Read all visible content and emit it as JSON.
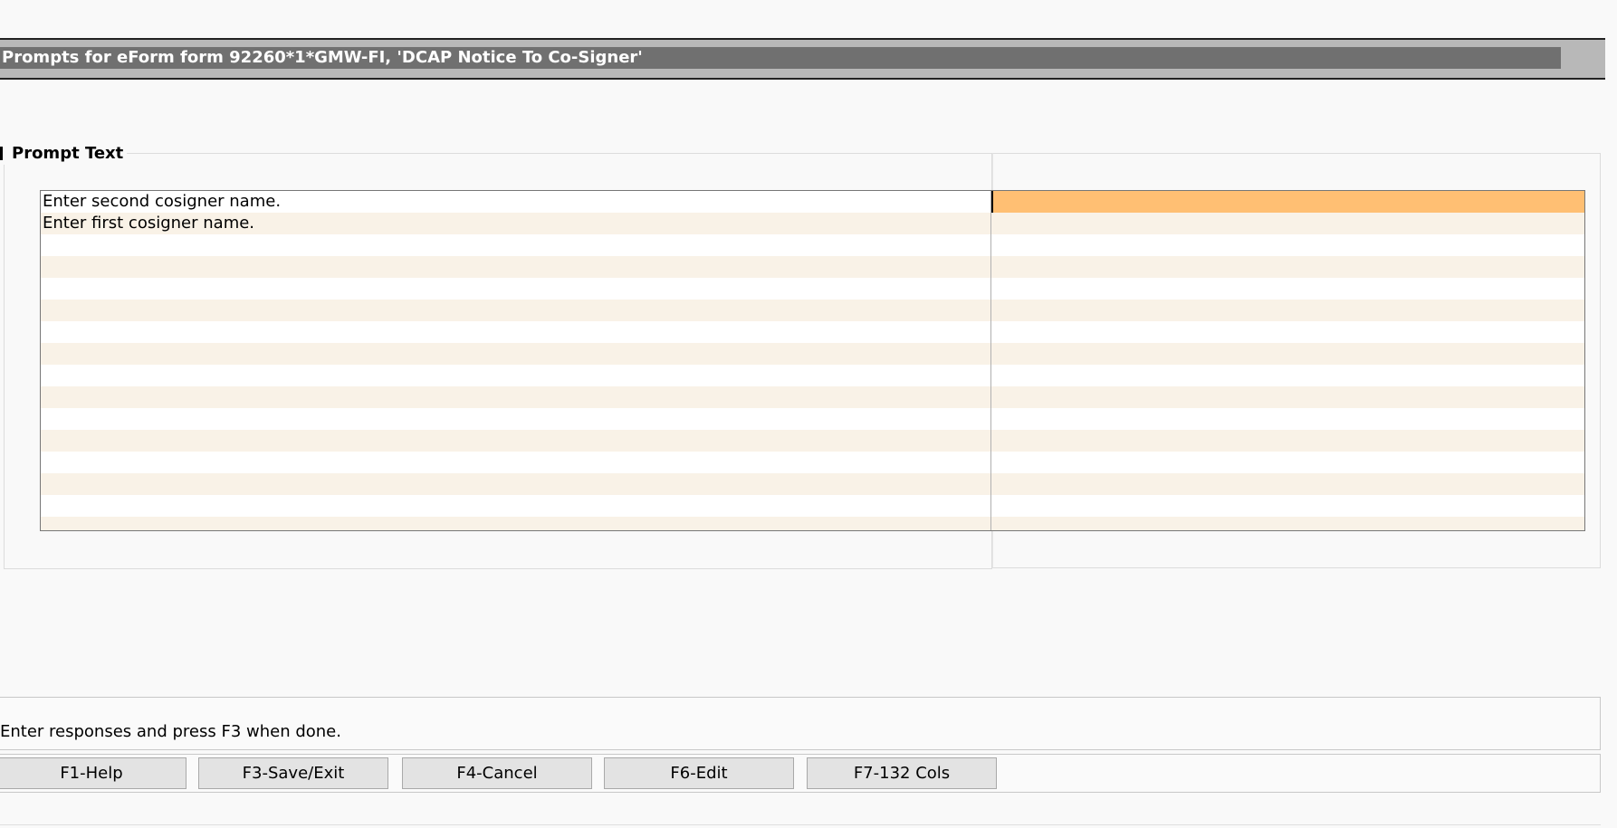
{
  "window": {
    "title": "Prompts for eForm form 92260*1*GMW-FI, 'DCAP Notice To Co-Signer'"
  },
  "group": {
    "label": "Prompt Text"
  },
  "grid": {
    "rows": [
      {
        "prompt": "Enter second cosigner name.",
        "response": "",
        "active": true
      },
      {
        "prompt": "Enter first cosigner name.",
        "response": "",
        "active": false
      },
      {
        "prompt": "",
        "response": ""
      },
      {
        "prompt": "",
        "response": ""
      },
      {
        "prompt": "",
        "response": ""
      },
      {
        "prompt": "",
        "response": ""
      },
      {
        "prompt": "",
        "response": ""
      },
      {
        "prompt": "",
        "response": ""
      },
      {
        "prompt": "",
        "response": ""
      },
      {
        "prompt": "",
        "response": ""
      },
      {
        "prompt": "",
        "response": ""
      },
      {
        "prompt": "",
        "response": ""
      },
      {
        "prompt": "",
        "response": ""
      },
      {
        "prompt": "",
        "response": ""
      },
      {
        "prompt": "",
        "response": ""
      },
      {
        "prompt": "",
        "response": ""
      }
    ]
  },
  "status": {
    "message": "Enter responses and press F3 when done."
  },
  "fkeys": {
    "f1": "F1-Help",
    "f3": "F3-Save/Exit",
    "f4": "F4-Cancel",
    "f6": "F6-Edit",
    "f7": "F7-132 Cols"
  },
  "colors": {
    "active_cell": "#ffbf73",
    "row_stripe": "#f9f2e7",
    "title_bar": "#707070"
  }
}
